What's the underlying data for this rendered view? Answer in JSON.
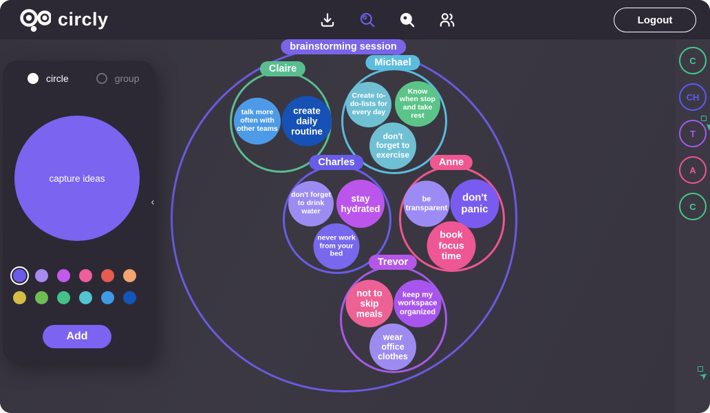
{
  "navbar": {
    "logo_text": "circly",
    "logout_label": "Logout",
    "active_icon_color": "#6C5FE8",
    "icon_color": "#FFFFFF"
  },
  "panel": {
    "radio_circle_label": "circle",
    "radio_group_label": "group",
    "preview_text": "capture  ideas",
    "add_label": "Add",
    "collapse_glyph": "‹",
    "colors": {
      "preview": "#7A64F0",
      "accent": "#7C63F2"
    },
    "palette": [
      "#6B5BE8",
      "#A78BF0",
      "#C35AEC",
      "#EE5D9C",
      "#E85B4F",
      "#F3A471",
      "#D4BE45",
      "#6FBC52",
      "#45C088",
      "#52C5CE",
      "#3E9BE8",
      "#1355B8"
    ],
    "selected_color_index": 0
  },
  "diagram": {
    "title": {
      "label": "brainstorming session",
      "pill_color": "#7A64E8",
      "ring_color": "#6A5AE0"
    },
    "groups": [
      {
        "label": "Claire",
        "pill_color": "#58BE90",
        "ring_color": "#58BE90",
        "ideas": [
          {
            "text": "talk more often with other teams",
            "color": "#4D9BE8"
          },
          {
            "text": "create daily routine",
            "color": "#1651B5"
          }
        ]
      },
      {
        "label": "Michael",
        "pill_color": "#5BBCDE",
        "ring_color": "#5BBCDE",
        "ideas": [
          {
            "text": "Create to-do-lists for every day",
            "color": "#6FC0D3"
          },
          {
            "text": "Know when stop and take rest",
            "color": "#5BC488"
          },
          {
            "text": "don't forget to exercise",
            "color": "#6FC0D3"
          }
        ]
      },
      {
        "label": "Charles",
        "pill_color": "#695CE8",
        "ring_color": "#695CE8",
        "ideas": [
          {
            "text": "don't forget to drink water",
            "color": "#9C8CF2"
          },
          {
            "text": "stay hydrated",
            "color": "#BC55EC"
          },
          {
            "text": "never work from your bed",
            "color": "#7768EE"
          }
        ]
      },
      {
        "label": "Anne",
        "pill_color": "#F0568F",
        "ring_color": "#F0568F",
        "ideas": [
          {
            "text": "be transparent",
            "color": "#9D8BF5"
          },
          {
            "text": "don't panic",
            "color": "#7A5BF0"
          },
          {
            "text": "book focus time",
            "color": "#EE5694"
          }
        ]
      },
      {
        "label": "Trevor",
        "pill_color": "#B457E8",
        "ring_color": "#A55AE8",
        "ideas": [
          {
            "text": "not to skip meals",
            "color": "#EE6195"
          },
          {
            "text": "keep my workspace organized",
            "color": "#A855EE"
          },
          {
            "text": "wear office clothes",
            "color": "#9D8BF0"
          }
        ]
      }
    ]
  },
  "sidebar": {
    "avatars": [
      {
        "initials": "C",
        "color": "#45C98C"
      },
      {
        "initials": "CH",
        "color": "#5B5BF5"
      },
      {
        "initials": "T",
        "color": "#A55AF0"
      },
      {
        "initials": "A",
        "color": "#F0558F"
      },
      {
        "initials": "C",
        "color": "#45C98C"
      }
    ],
    "cursor_color": "#3EBE8C"
  }
}
